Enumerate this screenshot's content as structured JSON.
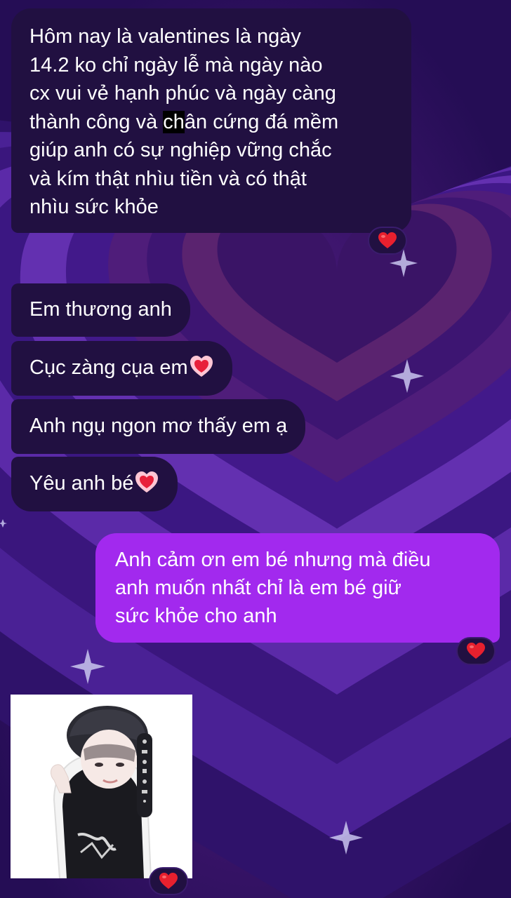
{
  "messages": [
    {
      "direction": "incoming",
      "lines": [
        "Hôm nay là valentines là ngày",
        "14.2 ko chỉ ngày lễ mà ngày nào",
        "cx vui vẻ hạnh phúc và ngày càng",
        "thành công và chân cứng đá mềm",
        "giúp anh có sự nghiệp vững chắc",
        "và kím thật nhìu tiền và có thật",
        "nhìu sức khỏe"
      ],
      "highlight": "ch",
      "reaction": "red-heart"
    },
    {
      "direction": "incoming",
      "text": "Em thương anh"
    },
    {
      "direction": "incoming",
      "text": "Cục zàng cụa em",
      "emoji": "pink-heart"
    },
    {
      "direction": "incoming",
      "text": "Anh ngụ ngon mơ thấy em ạ"
    },
    {
      "direction": "incoming",
      "text": "Yêu anh bé",
      "emoji": "pink-heart"
    },
    {
      "direction": "outgoing",
      "lines": [
        "Anh cảm ơn em bé nhưng mà điều",
        "anh muốn nhất chỉ là em bé giữ",
        "sức khỏe cho anh"
      ],
      "reaction": "red-heart"
    },
    {
      "direction": "incoming",
      "type": "sticker-photo",
      "description_icon": "person-sticker",
      "reaction": "red-heart"
    }
  ],
  "colors": {
    "background": "#2a0f5e",
    "incoming_bubble": "#211041",
    "outgoing_bubble": "#a229ee",
    "text": "#ffffff",
    "reaction_heart": "#e8202e"
  }
}
